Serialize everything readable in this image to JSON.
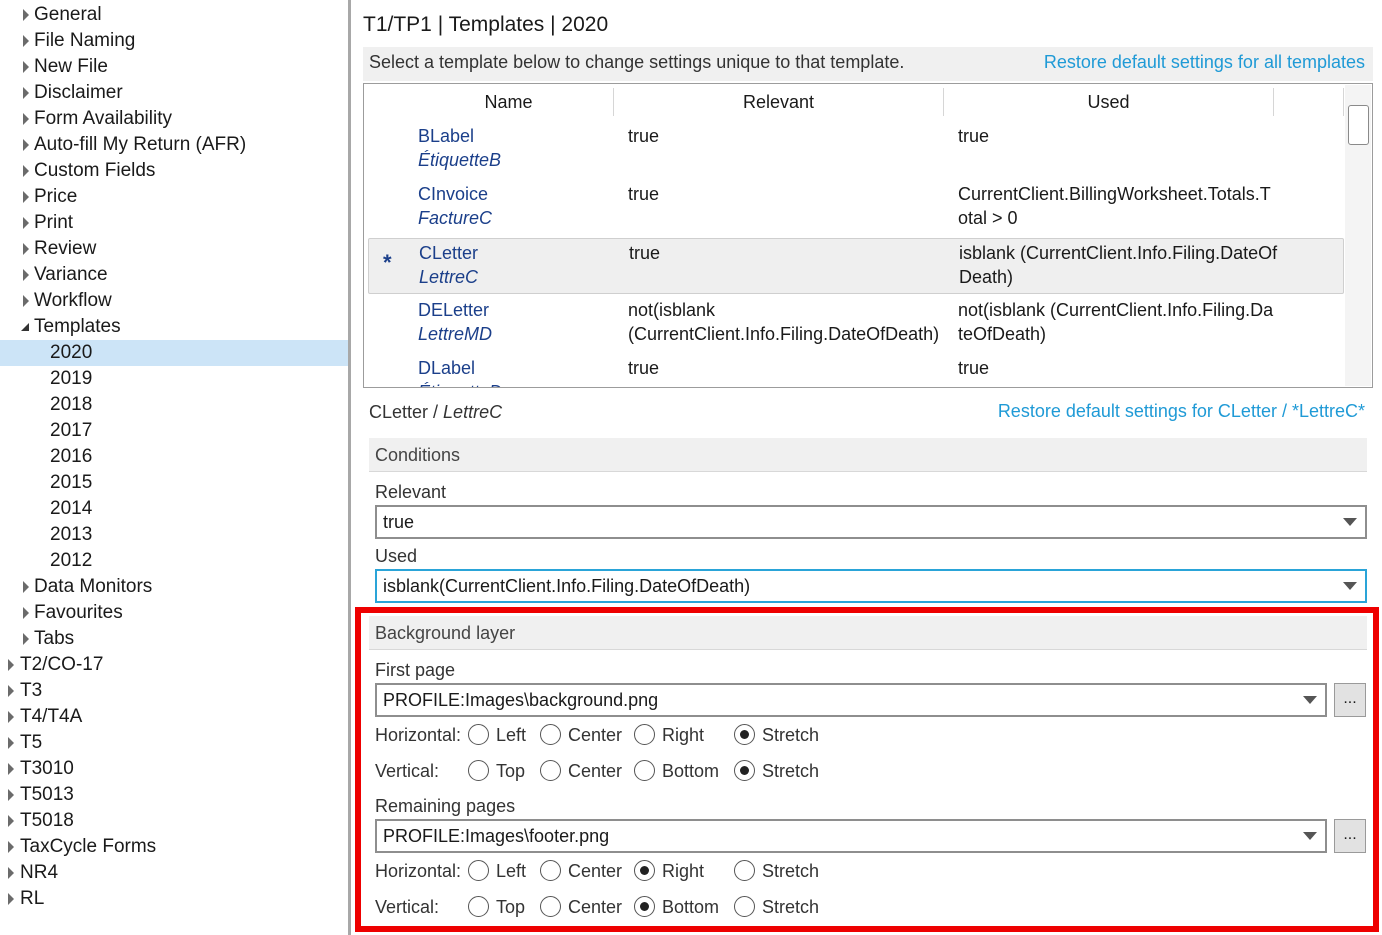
{
  "tree": {
    "items": [
      {
        "label": "General",
        "expander": "right"
      },
      {
        "label": "File Naming",
        "expander": "right"
      },
      {
        "label": "New File",
        "expander": "right"
      },
      {
        "label": "Disclaimer",
        "expander": "right"
      },
      {
        "label": "Form Availability",
        "expander": "right"
      },
      {
        "label": "Auto-fill My Return (AFR)",
        "expander": "right"
      },
      {
        "label": "Custom Fields",
        "expander": "right"
      },
      {
        "label": "Price",
        "expander": "right"
      },
      {
        "label": "Print",
        "expander": "right"
      },
      {
        "label": "Review",
        "expander": "right"
      },
      {
        "label": "Variance",
        "expander": "right"
      },
      {
        "label": "Workflow",
        "expander": "right"
      },
      {
        "label": "Templates",
        "expander": "down"
      },
      {
        "label": "2020",
        "expander": "none",
        "selected": true
      },
      {
        "label": "2019",
        "expander": "none"
      },
      {
        "label": "2018",
        "expander": "none"
      },
      {
        "label": "2017",
        "expander": "none"
      },
      {
        "label": "2016",
        "expander": "none"
      },
      {
        "label": "2015",
        "expander": "none"
      },
      {
        "label": "2014",
        "expander": "none"
      },
      {
        "label": "2013",
        "expander": "none"
      },
      {
        "label": "2012",
        "expander": "none"
      },
      {
        "label": "Data Monitors",
        "expander": "right"
      },
      {
        "label": "Favourites",
        "expander": "right"
      },
      {
        "label": "Tabs",
        "expander": "right"
      },
      {
        "label": "T2/CO-17",
        "expander": "right"
      },
      {
        "label": "T3",
        "expander": "right"
      },
      {
        "label": "T4/T4A",
        "expander": "right"
      },
      {
        "label": "T5",
        "expander": "right"
      },
      {
        "label": "T3010",
        "expander": "right"
      },
      {
        "label": "T5013",
        "expander": "right"
      },
      {
        "label": "T5018",
        "expander": "right"
      },
      {
        "label": "TaxCycle Forms",
        "expander": "right"
      },
      {
        "label": "NR4",
        "expander": "right"
      },
      {
        "label": "RL",
        "expander": "right"
      }
    ]
  },
  "header": {
    "title": "T1/TP1 | Templates | 2020",
    "hint": "Select a template below to change settings unique to that template.",
    "restore_all": "Restore default settings for all templates"
  },
  "grid": {
    "columns": [
      "Name",
      "Relevant",
      "Used"
    ],
    "rows": [
      {
        "name": "BLabel",
        "french": "ÉtiquetteB",
        "relevant": "true",
        "used": "true",
        "marker": ""
      },
      {
        "name": "CInvoice",
        "french": "FactureC",
        "relevant": "true",
        "used": "CurrentClient.BillingWorksheet.Totals.Total > 0",
        "marker": ""
      },
      {
        "name": "CLetter",
        "french": "LettreC",
        "relevant": "true",
        "used": "isblank (CurrentClient.Info.Filing.DateOfDeath)",
        "marker": "*",
        "selected": true
      },
      {
        "name": "DELetter",
        "french": "LettreMD",
        "relevant": "not(isblank (CurrentClient.Info.Filing.DateOfDeath)",
        "used": "not(isblank (CurrentClient.Info.Filing.DateOfDeath)",
        "marker": ""
      },
      {
        "name": "DLabel",
        "french": "ÉtiquetteD",
        "relevant": "true",
        "used": "true",
        "marker": ""
      }
    ]
  },
  "selected": {
    "name": "CLetter",
    "separator": " / ",
    "french": "LettreC",
    "restore": "Restore default settings for CLetter / *LettreC*"
  },
  "conditions": {
    "heading": "Conditions",
    "relevant_label": "Relevant",
    "relevant_value": "true",
    "used_label": "Used",
    "used_value": "isblank(CurrentClient.Info.Filing.DateOfDeath)"
  },
  "background": {
    "heading": "Background layer",
    "first_page": {
      "label": "First page",
      "file": "PROFILE:Images\\background.png",
      "browse": "...",
      "horizontal_label": "Horizontal:",
      "horizontal_options": [
        "Left",
        "Center",
        "Right",
        "Stretch"
      ],
      "horizontal_selected": "Stretch",
      "vertical_label": "Vertical:",
      "vertical_options": [
        "Top",
        "Center",
        "Bottom",
        "Stretch"
      ],
      "vertical_selected": "Stretch"
    },
    "remaining_pages": {
      "label": "Remaining pages",
      "file": "PROFILE:Images\\footer.png",
      "browse": "...",
      "horizontal_label": "Horizontal:",
      "horizontal_options": [
        "Left",
        "Center",
        "Right",
        "Stretch"
      ],
      "horizontal_selected": "Right",
      "vertical_label": "Vertical:",
      "vertical_options": [
        "Top",
        "Center",
        "Bottom",
        "Stretch"
      ],
      "vertical_selected": "Bottom"
    }
  },
  "colors": {
    "link": "#1f9ad6",
    "selection": "#cce4f7",
    "highlight_box": "#ee0000",
    "focus_border": "#2aa4d8"
  }
}
